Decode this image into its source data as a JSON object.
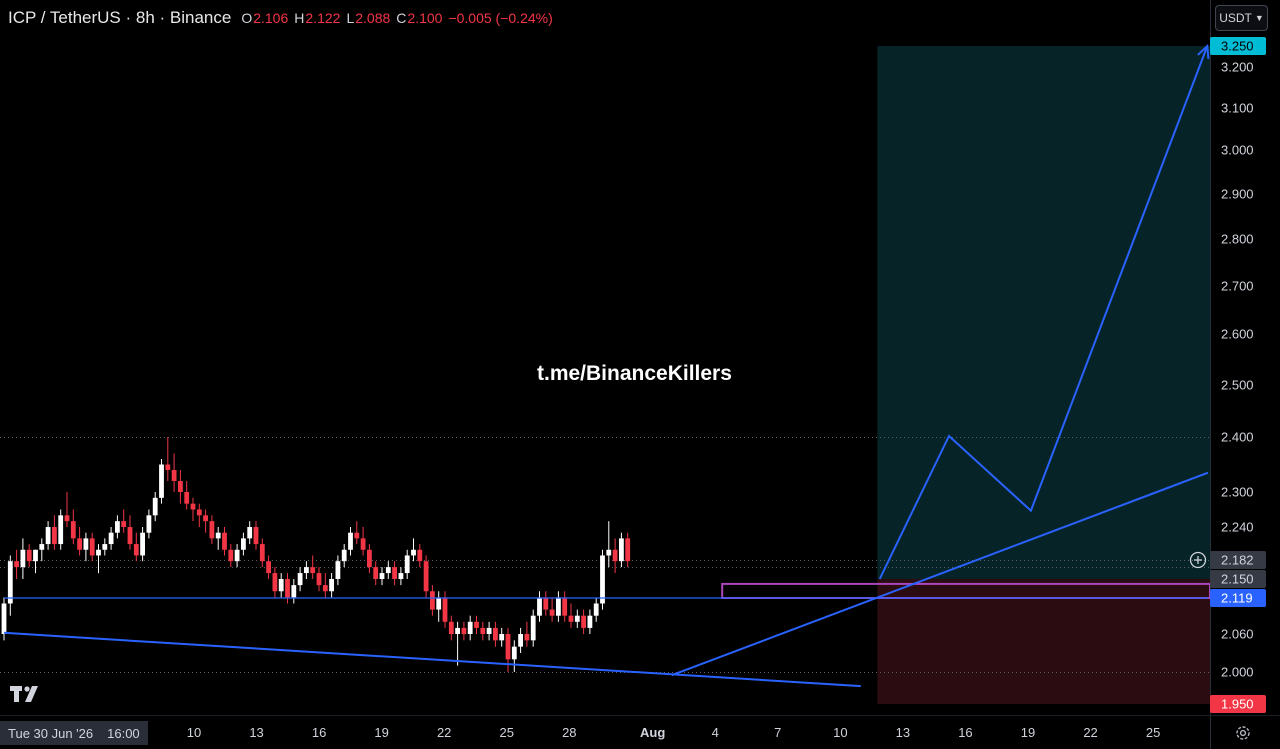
{
  "header": {
    "symbol": "ICP / TetherUS · 8h · Binance",
    "open_label": "O",
    "open": "2.106",
    "high_label": "H",
    "high": "2.122",
    "low_label": "L",
    "low": "2.088",
    "close_label": "C",
    "close": "2.100",
    "change": "−0.005 (−0.24%)"
  },
  "currency_button": {
    "label": "USDT"
  },
  "watermark": "t.me/BinanceKillers",
  "date_tag": {
    "date": "Tue 30 Jun '26",
    "time": "16:00"
  },
  "icons": [
    "tradingview-logo-icon",
    "settings-icon",
    "plus-circle-icon",
    "chevron-down-icon"
  ],
  "colors": {
    "up": "#ffffff",
    "down": "#f23645",
    "trendline": "#2962ff",
    "target_zone": "#0b3a3d",
    "stop_zone": "#4a1216",
    "box": "#9c27b0",
    "last_price_tag": "#2962ff",
    "target_tag": "#00bcd4",
    "stop_tag": "#f23645"
  },
  "chart_data": {
    "type": "candlestick",
    "symbol": "ICPUSDT",
    "interval": "8h",
    "y_axis": {
      "ylim": [
        1.93,
        3.27
      ],
      "ticks": [
        "3.200",
        "3.100",
        "3.000",
        "2.900",
        "2.800",
        "2.700",
        "2.600",
        "2.500",
        "2.400",
        "2.300",
        "2.240",
        "2.060",
        "2.000"
      ],
      "labels": [
        {
          "text": "3.250",
          "value": 3.25,
          "style": "target"
        },
        {
          "text": "2.182",
          "value": 2.182,
          "style": "grey"
        },
        {
          "text": "2.150",
          "value": 2.15,
          "style": "grey"
        },
        {
          "text": "2.119",
          "value": 2.119,
          "style": "last"
        },
        {
          "text": "1.950",
          "value": 1.95,
          "style": "stop"
        }
      ]
    },
    "x_axis": {
      "ticks": [
        {
          "label": "10",
          "day": 10
        },
        {
          "label": "13",
          "day": 13
        },
        {
          "label": "16",
          "day": 16
        },
        {
          "label": "19",
          "day": 19
        },
        {
          "label": "22",
          "day": 22
        },
        {
          "label": "25",
          "day": 25
        },
        {
          "label": "28",
          "day": 28
        },
        {
          "label": "Aug",
          "day": 32
        },
        {
          "label": "4",
          "day": 35
        },
        {
          "label": "7",
          "day": 38
        },
        {
          "label": "10",
          "day": 41
        },
        {
          "label": "13",
          "day": 44
        },
        {
          "label": "16",
          "day": 47
        },
        {
          "label": "19",
          "day": 50
        },
        {
          "label": "22",
          "day": 53
        },
        {
          "label": "25",
          "day": 56
        }
      ]
    },
    "candles": [
      [
        2.06,
        2.12,
        2.05,
        2.11
      ],
      [
        2.11,
        2.19,
        2.09,
        2.18
      ],
      [
        2.18,
        2.2,
        2.15,
        2.17
      ],
      [
        2.17,
        2.22,
        2.15,
        2.2
      ],
      [
        2.2,
        2.21,
        2.17,
        2.18
      ],
      [
        2.18,
        2.2,
        2.16,
        2.2
      ],
      [
        2.2,
        2.22,
        2.18,
        2.21
      ],
      [
        2.21,
        2.25,
        2.2,
        2.24
      ],
      [
        2.24,
        2.26,
        2.2,
        2.21
      ],
      [
        2.21,
        2.27,
        2.2,
        2.26
      ],
      [
        2.26,
        2.3,
        2.24,
        2.25
      ],
      [
        2.25,
        2.27,
        2.21,
        2.22
      ],
      [
        2.22,
        2.24,
        2.19,
        2.2
      ],
      [
        2.2,
        2.23,
        2.18,
        2.22
      ],
      [
        2.22,
        2.23,
        2.18,
        2.19
      ],
      [
        2.19,
        2.21,
        2.16,
        2.2
      ],
      [
        2.2,
        2.22,
        2.19,
        2.21
      ],
      [
        2.21,
        2.24,
        2.2,
        2.23
      ],
      [
        2.23,
        2.26,
        2.22,
        2.25
      ],
      [
        2.25,
        2.27,
        2.23,
        2.24
      ],
      [
        2.24,
        2.26,
        2.2,
        2.21
      ],
      [
        2.21,
        2.23,
        2.18,
        2.19
      ],
      [
        2.19,
        2.24,
        2.18,
        2.23
      ],
      [
        2.23,
        2.27,
        2.22,
        2.26
      ],
      [
        2.26,
        2.3,
        2.25,
        2.29
      ],
      [
        2.29,
        2.36,
        2.28,
        2.35
      ],
      [
        2.35,
        2.4,
        2.32,
        2.34
      ],
      [
        2.34,
        2.37,
        2.3,
        2.32
      ],
      [
        2.32,
        2.34,
        2.28,
        2.3
      ],
      [
        2.3,
        2.32,
        2.27,
        2.28
      ],
      [
        2.28,
        2.29,
        2.25,
        2.27
      ],
      [
        2.27,
        2.28,
        2.24,
        2.26
      ],
      [
        2.26,
        2.27,
        2.23,
        2.25
      ],
      [
        2.25,
        2.26,
        2.21,
        2.22
      ],
      [
        2.22,
        2.24,
        2.2,
        2.23
      ],
      [
        2.23,
        2.24,
        2.19,
        2.2
      ],
      [
        2.2,
        2.21,
        2.17,
        2.18
      ],
      [
        2.18,
        2.21,
        2.17,
        2.2
      ],
      [
        2.2,
        2.23,
        2.19,
        2.22
      ],
      [
        2.22,
        2.25,
        2.21,
        2.24
      ],
      [
        2.24,
        2.25,
        2.2,
        2.21
      ],
      [
        2.21,
        2.22,
        2.17,
        2.18
      ],
      [
        2.18,
        2.19,
        2.15,
        2.16
      ],
      [
        2.16,
        2.17,
        2.12,
        2.13
      ],
      [
        2.13,
        2.16,
        2.12,
        2.15
      ],
      [
        2.15,
        2.16,
        2.11,
        2.12
      ],
      [
        2.12,
        2.15,
        2.11,
        2.14
      ],
      [
        2.14,
        2.17,
        2.13,
        2.16
      ],
      [
        2.16,
        2.18,
        2.15,
        2.17
      ],
      [
        2.17,
        2.19,
        2.15,
        2.16
      ],
      [
        2.16,
        2.17,
        2.13,
        2.14
      ],
      [
        2.14,
        2.16,
        2.12,
        2.13
      ],
      [
        2.13,
        2.16,
        2.12,
        2.15
      ],
      [
        2.15,
        2.19,
        2.14,
        2.18
      ],
      [
        2.18,
        2.21,
        2.17,
        2.2
      ],
      [
        2.2,
        2.24,
        2.19,
        2.23
      ],
      [
        2.23,
        2.25,
        2.21,
        2.22
      ],
      [
        2.22,
        2.24,
        2.19,
        2.2
      ],
      [
        2.2,
        2.21,
        2.16,
        2.17
      ],
      [
        2.17,
        2.18,
        2.14,
        2.15
      ],
      [
        2.15,
        2.17,
        2.14,
        2.16
      ],
      [
        2.16,
        2.18,
        2.15,
        2.17
      ],
      [
        2.17,
        2.18,
        2.14,
        2.15
      ],
      [
        2.15,
        2.17,
        2.14,
        2.16
      ],
      [
        2.16,
        2.2,
        2.15,
        2.19
      ],
      [
        2.19,
        2.22,
        2.18,
        2.2
      ],
      [
        2.2,
        2.21,
        2.17,
        2.18
      ],
      [
        2.18,
        2.19,
        2.12,
        2.13
      ],
      [
        2.13,
        2.14,
        2.09,
        2.1
      ],
      [
        2.1,
        2.13,
        2.08,
        2.12
      ],
      [
        2.12,
        2.13,
        2.07,
        2.08
      ],
      [
        2.08,
        2.09,
        2.05,
        2.06
      ],
      [
        2.06,
        2.08,
        2.01,
        2.07
      ],
      [
        2.07,
        2.08,
        2.05,
        2.06
      ],
      [
        2.06,
        2.09,
        2.05,
        2.08
      ],
      [
        2.08,
        2.09,
        2.06,
        2.07
      ],
      [
        2.07,
        2.08,
        2.05,
        2.06
      ],
      [
        2.06,
        2.08,
        2.05,
        2.07
      ],
      [
        2.07,
        2.08,
        2.04,
        2.05
      ],
      [
        2.05,
        2.07,
        2.04,
        2.06
      ],
      [
        2.06,
        2.07,
        2.0,
        2.02
      ],
      [
        2.02,
        2.05,
        2.0,
        2.04
      ],
      [
        2.04,
        2.07,
        2.03,
        2.06
      ],
      [
        2.06,
        2.08,
        2.04,
        2.05
      ],
      [
        2.05,
        2.1,
        2.04,
        2.09
      ],
      [
        2.09,
        2.13,
        2.08,
        2.12
      ],
      [
        2.12,
        2.13,
        2.09,
        2.1
      ],
      [
        2.1,
        2.12,
        2.08,
        2.09
      ],
      [
        2.09,
        2.13,
        2.08,
        2.12
      ],
      [
        2.12,
        2.13,
        2.08,
        2.09
      ],
      [
        2.09,
        2.11,
        2.07,
        2.08
      ],
      [
        2.08,
        2.1,
        2.07,
        2.09
      ],
      [
        2.09,
        2.1,
        2.06,
        2.07
      ],
      [
        2.07,
        2.1,
        2.06,
        2.09
      ],
      [
        2.09,
        2.12,
        2.08,
        2.11
      ],
      [
        2.11,
        2.2,
        2.1,
        2.19
      ],
      [
        2.19,
        2.25,
        2.17,
        2.2
      ],
      [
        2.2,
        2.22,
        2.16,
        2.18
      ],
      [
        2.18,
        2.23,
        2.17,
        2.22
      ],
      [
        2.22,
        2.23,
        2.17,
        2.18
      ]
    ],
    "lines": [
      {
        "name": "descending-trendline",
        "points": [
          [
            0,
            2.062
          ],
          [
            136,
            1.978
          ]
        ]
      },
      {
        "name": "ascending-trendline",
        "points": [
          [
            106,
            1.995
          ],
          [
            193,
            2.335
          ]
        ]
      },
      {
        "name": "support-line",
        "points": [
          [
            0,
            2.119
          ],
          [
            193,
            2.119
          ]
        ]
      },
      {
        "name": "projection-path",
        "points": [
          [
            139,
            2.15
          ],
          [
            150,
            2.402
          ],
          [
            163,
            2.268
          ],
          [
            191,
            3.25
          ]
        ]
      }
    ],
    "zones": [
      {
        "name": "target-zone",
        "x": [
          138,
          193
        ],
        "y": [
          2.15,
          3.25
        ]
      },
      {
        "name": "stop-zone",
        "x": [
          138,
          193
        ],
        "y": [
          1.95,
          2.15
        ]
      },
      {
        "name": "entry-box",
        "x": [
          114,
          193
        ],
        "y": [
          2.119,
          2.142
        ]
      }
    ],
    "reference_levels": [
      2.4,
      2.182,
      2.17,
      2.0
    ]
  }
}
